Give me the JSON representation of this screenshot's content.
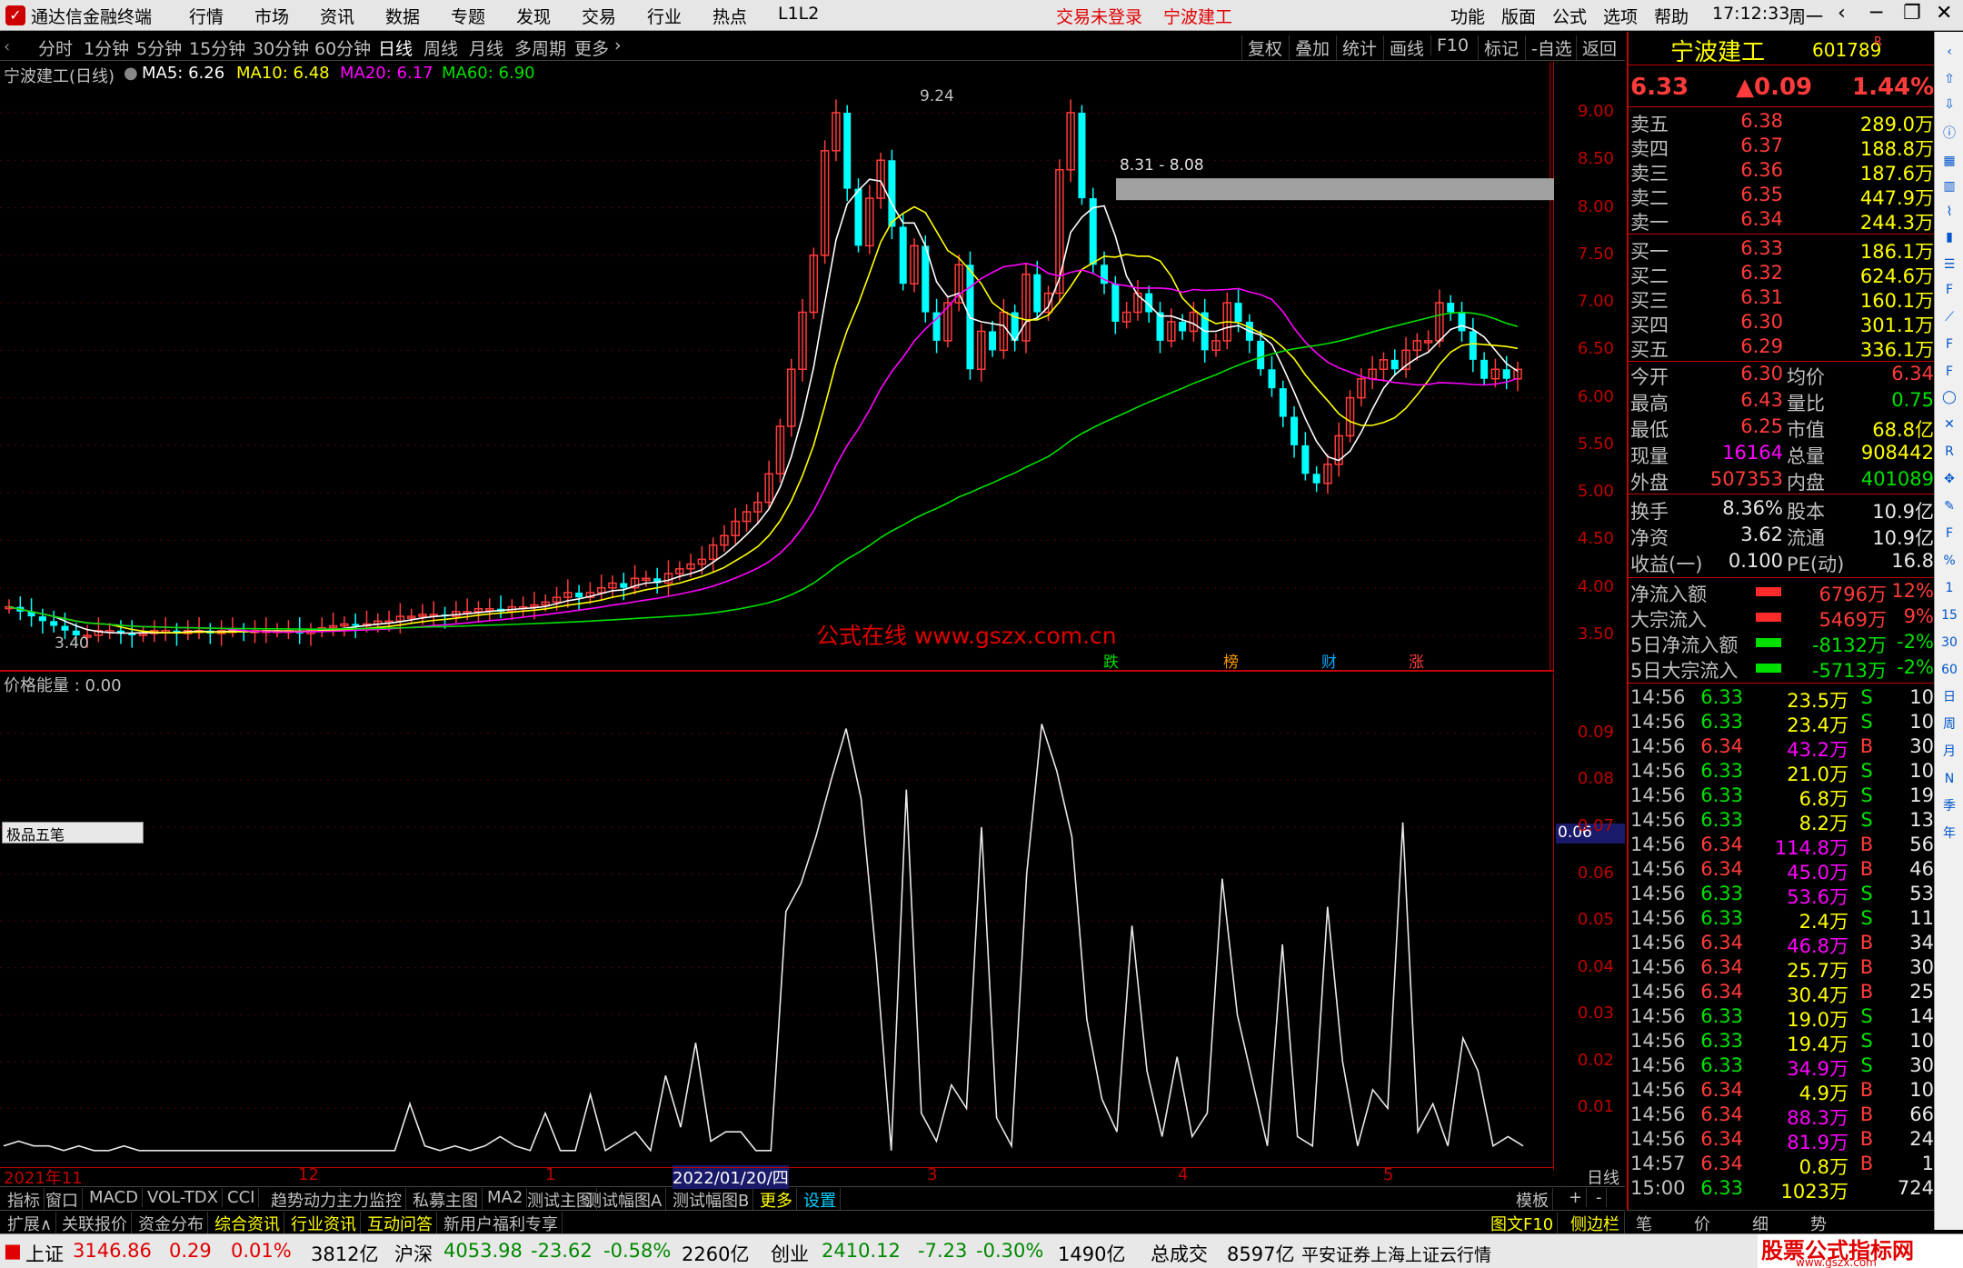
{
  "titlebar": {
    "app_title": "通达信金融终端",
    "menus": [
      "行情",
      "市场",
      "资讯",
      "数据",
      "专题",
      "发现",
      "交易",
      "行业",
      "热点",
      "L1L2"
    ],
    "login_status": "交易未登录",
    "stock_name": "宁波建工",
    "right_menus": [
      "功能",
      "版面",
      "公式",
      "选项",
      "帮助"
    ],
    "time": "17:12:33",
    "weekday": "周一"
  },
  "periodbar": {
    "periods": [
      "分时",
      "1分钟",
      "5分钟",
      "15分钟",
      "30分钟",
      "60分钟",
      "日线",
      "周线",
      "月线",
      "多周期",
      "更多"
    ],
    "active": "日线",
    "right_buttons": [
      "复权",
      "叠加",
      "统计",
      "画线",
      "F10",
      "标记",
      "-自选",
      "返回"
    ]
  },
  "main_chart": {
    "stock_label": "宁波建工(日线)",
    "ma5": "MA5: 6.26",
    "ma10": "MA10: 6.48",
    "ma20": "MA20: 6.17",
    "ma60": "MA60: 6.90",
    "high_label": "9.24",
    "low_label": "3.40",
    "range_label": "8.31 - 8.08",
    "watermark": "公式在线  www.gszx.com.cn",
    "markers": [
      "跌",
      "榜",
      "财",
      "涨"
    ],
    "colors": {
      "ma5": "#ffffff",
      "ma10": "#ffff00",
      "ma20": "#ff00ff",
      "ma60": "#00e000",
      "up": "#ff3b3b",
      "down": "#00ffff"
    }
  },
  "chart_data": {
    "type": "line",
    "series": [
      {
        "name": "价格能量",
        "values": [
          0.002,
          0.003,
          0.002,
          0.002,
          0.001,
          0.002,
          0.001,
          0.001,
          0.002,
          0.001,
          0.001,
          0.001,
          0.001,
          0.001,
          0.001,
          0.001,
          0.001,
          0.001,
          0.001,
          0.001,
          0.001,
          0.001,
          0.001,
          0.001,
          0.001,
          0.001,
          0.001,
          0.011,
          0.002,
          0.001,
          0.002,
          0.001,
          0.002,
          0.004,
          0.002,
          0.001,
          0.009,
          0.001,
          0.001,
          0.013,
          0.001,
          0.003,
          0.005,
          0.001,
          0.017,
          0.006,
          0.024,
          0.003,
          0.005,
          0.005,
          0.001,
          0.001,
          0.052,
          0.058,
          0.068,
          0.08,
          0.091,
          0.076,
          0.042,
          0.001,
          0.078,
          0.009,
          0.003,
          0.015,
          0.01,
          0.07,
          0.008,
          0.002,
          0.06,
          0.092,
          0.082,
          0.068,
          0.029,
          0.012,
          0.005,
          0.049,
          0.018,
          0.004,
          0.021,
          0.004,
          0.009,
          0.059,
          0.03,
          0.016,
          0.002,
          0.045,
          0.004,
          0.002,
          0.053,
          0.02,
          0.002,
          0.014,
          0.01,
          0.071,
          0.005,
          0.011,
          0.002,
          0.025,
          0.018,
          0.002,
          0.004,
          0.002
        ]
      }
    ],
    "ylim": [
      0,
      0.095
    ],
    "yticks": [
      "0.09",
      "0.08",
      "0.07",
      "0.06",
      "0.05",
      "0.04",
      "0.03",
      "0.02",
      "0.01"
    ],
    "indicator_label": "价格能量 : 0.00",
    "current_value": "0.06",
    "price_ticks": [
      "9.00",
      "8.50",
      "8.00",
      "7.50",
      "7.00",
      "6.50",
      "6.00",
      "5.50",
      "5.00",
      "4.50",
      "4.00",
      "3.50"
    ],
    "date_labels": [
      "2021年11",
      "12",
      "1",
      "2022/01/20/四",
      "3",
      "4",
      "5"
    ],
    "period_label": "日线"
  },
  "subchart": {
    "tool_label": "极品五笔"
  },
  "quote": {
    "name": "宁波建工",
    "code": "601789",
    "suffix": "R",
    "price": "6.33",
    "change": "▲0.09",
    "pct": "1.44%",
    "sell": [
      {
        "label": "卖五",
        "price": "6.38",
        "vol": "289.0万"
      },
      {
        "label": "卖四",
        "price": "6.37",
        "vol": "188.8万"
      },
      {
        "label": "卖三",
        "price": "6.36",
        "vol": "187.6万"
      },
      {
        "label": "卖二",
        "price": "6.35",
        "vol": "447.9万"
      },
      {
        "label": "卖一",
        "price": "6.34",
        "vol": "244.3万"
      }
    ],
    "buy": [
      {
        "label": "买一",
        "price": "6.33",
        "vol": "186.1万"
      },
      {
        "label": "买二",
        "price": "6.32",
        "vol": "624.6万"
      },
      {
        "label": "买三",
        "price": "6.31",
        "vol": "160.1万"
      },
      {
        "label": "买四",
        "price": "6.30",
        "vol": "301.1万"
      },
      {
        "label": "买五",
        "price": "6.29",
        "vol": "336.1万"
      }
    ],
    "stats": [
      {
        "k1": "今开",
        "v1": "6.30",
        "k2": "均价",
        "v2": "6.34"
      },
      {
        "k1": "最高",
        "v1": "6.43",
        "k2": "量比",
        "v2": "0.75"
      },
      {
        "k1": "最低",
        "v1": "6.25",
        "k2": "市值",
        "v2": "68.8亿"
      },
      {
        "k1": "现量",
        "v1": "16164",
        "k2": "总量",
        "v2": "908442"
      },
      {
        "k1": "外盘",
        "v1": "507353",
        "k2": "内盘",
        "v2": "401089"
      }
    ],
    "stats2": [
      {
        "k1": "换手",
        "v1": "8.36%",
        "k2": "股本",
        "v2": "10.9亿"
      },
      {
        "k1": "净资",
        "v1": "3.62",
        "k2": "流通",
        "v2": "10.9亿"
      },
      {
        "k1": "收益(一)",
        "v1": "0.100",
        "k2": "PE(动)",
        "v2": "16.8"
      }
    ],
    "flows": [
      {
        "k": "净流入额",
        "v": "6796万",
        "p": "12%"
      },
      {
        "k": "大宗流入",
        "v": "5469万",
        "p": "9%"
      },
      {
        "k": "5日净流入额",
        "v": "-8132万",
        "p": "-2%"
      },
      {
        "k": "5日大宗流入",
        "v": "-5713万",
        "p": "-2%"
      }
    ],
    "ticks": [
      {
        "t": "14:56",
        "p": "6.33",
        "v": "23.5万",
        "s": "S",
        "n": "10"
      },
      {
        "t": "14:56",
        "p": "6.33",
        "v": "23.4万",
        "s": "S",
        "n": "10"
      },
      {
        "t": "14:56",
        "p": "6.34",
        "v": "43.2万",
        "s": "B",
        "n": "30"
      },
      {
        "t": "14:56",
        "p": "6.33",
        "v": "21.0万",
        "s": "S",
        "n": "10"
      },
      {
        "t": "14:56",
        "p": "6.33",
        "v": "6.8万",
        "s": "S",
        "n": "19"
      },
      {
        "t": "14:56",
        "p": "6.33",
        "v": "8.2万",
        "s": "S",
        "n": "13"
      },
      {
        "t": "14:56",
        "p": "6.34",
        "v": "114.8万",
        "s": "B",
        "n": "56"
      },
      {
        "t": "14:56",
        "p": "6.34",
        "v": "45.0万",
        "s": "B",
        "n": "46"
      },
      {
        "t": "14:56",
        "p": "6.33",
        "v": "53.6万",
        "s": "S",
        "n": "53"
      },
      {
        "t": "14:56",
        "p": "6.33",
        "v": "2.4万",
        "s": "S",
        "n": "11"
      },
      {
        "t": "14:56",
        "p": "6.34",
        "v": "46.8万",
        "s": "B",
        "n": "34"
      },
      {
        "t": "14:56",
        "p": "6.34",
        "v": "25.7万",
        "s": "B",
        "n": "30"
      },
      {
        "t": "14:56",
        "p": "6.34",
        "v": "30.4万",
        "s": "B",
        "n": "25"
      },
      {
        "t": "14:56",
        "p": "6.33",
        "v": "19.0万",
        "s": "S",
        "n": "14"
      },
      {
        "t": "14:56",
        "p": "6.33",
        "v": "19.4万",
        "s": "S",
        "n": "10"
      },
      {
        "t": "14:56",
        "p": "6.33",
        "v": "34.9万",
        "s": "S",
        "n": "30"
      },
      {
        "t": "14:56",
        "p": "6.34",
        "v": "4.9万",
        "s": "B",
        "n": "10"
      },
      {
        "t": "14:56",
        "p": "6.34",
        "v": "88.3万",
        "s": "B",
        "n": "66"
      },
      {
        "t": "14:56",
        "p": "6.34",
        "v": "81.9万",
        "s": "B",
        "n": "24"
      },
      {
        "t": "14:57",
        "p": "6.34",
        "v": "0.8万",
        "s": "B",
        "n": "1"
      },
      {
        "t": "15:00",
        "p": "6.33",
        "v": "1023万",
        "s": "",
        "n": "724"
      }
    ]
  },
  "tabs1": [
    "指标",
    "窗口",
    "MACD",
    "VOL-TDX",
    "CCI",
    "趋势动力",
    "主力监控",
    "私募主图",
    "MA2",
    "测试主图",
    "测试幅图A",
    "测试幅图B",
    "更多",
    "设置"
  ],
  "tabs1_right": [
    "模板",
    "+",
    "-"
  ],
  "tabs2": [
    "扩展∧",
    "关联报价",
    "资金分布",
    "综合资讯",
    "行业资讯",
    "互动问答",
    "新用户福利专享"
  ],
  "tabs2_right": [
    "图文F10",
    "侧边栏《",
    "笔",
    "价",
    "细",
    "势"
  ],
  "statusbar": {
    "sh_label": "上证",
    "sh_val": "3146.86",
    "sh_chg": "0.29",
    "sh_pct": "0.01%",
    "sh_amt": "3812亿",
    "hs_label": "沪深",
    "hs_val": "4053.98",
    "hs_chg": "-23.62",
    "hs_pct": "-0.58%",
    "hs_amt": "2260亿",
    "cy_label": "创业",
    "cy_val": "2410.12",
    "cy_chg": "-7.23",
    "cy_pct": "-0.30%",
    "cy_amt": "1490亿",
    "total_label": "总成交",
    "total_val": "8597亿",
    "server": "平安证券上海上证云行情",
    "brand": "股票公式指标网",
    "brand_url": "www.gszx.com"
  }
}
